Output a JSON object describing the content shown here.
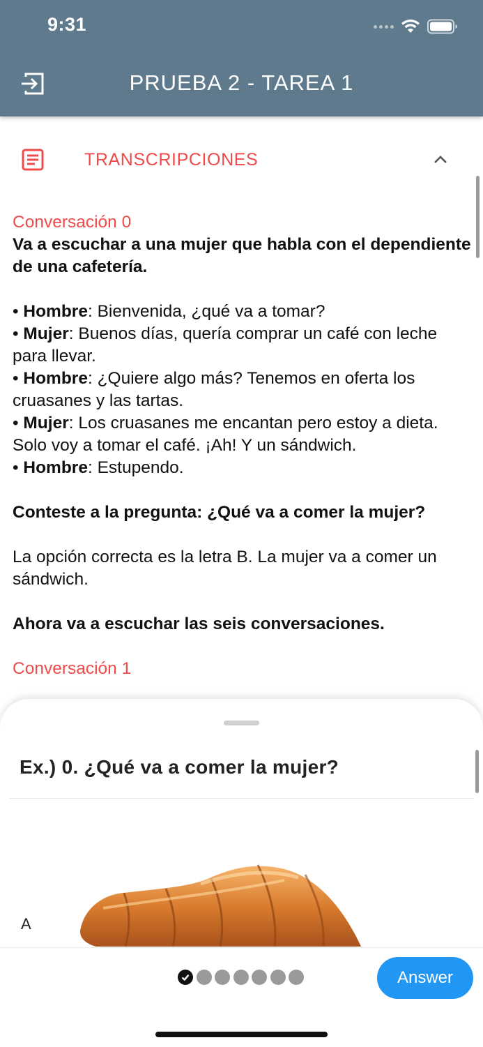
{
  "status": {
    "time": "9:31"
  },
  "header": {
    "title": "PRUEBA 2 - TAREA 1",
    "exit_icon": "exit-icon"
  },
  "accordion": {
    "title": "TRANSCRIPCIONES",
    "icon": "document-icon",
    "chevron": "chevron-up-icon"
  },
  "transcript": {
    "conv0_label": "Conversación 0",
    "intro": "Va a escuchar a una mujer que habla con el dependiente de una cafetería.",
    "lines": [
      {
        "speaker": "Hombre",
        "text": ": Bienvenida, ¿qué va a tomar?"
      },
      {
        "speaker": "Mujer",
        "text": ": Buenos días, quería comprar un café con leche para llevar."
      },
      {
        "speaker": "Hombre",
        "text": ": ¿Quiere algo más? Tenemos en oferta los cruasanes y las tartas."
      },
      {
        "speaker": "Mujer",
        "text": ": Los cruasanes me encantan pero estoy a dieta. Solo voy a tomar el café. ¡Ah! Y un sándwich."
      },
      {
        "speaker": "Hombre",
        "text": ": Estupendo."
      }
    ],
    "bullet": "•",
    "question": "Conteste a la pregunta: ¿Qué va a comer la mujer?",
    "answer": "La opción correcta es la letra B. La mujer va a comer un sándwich.",
    "outro": "Ahora va a escuchar las seis conversaciones.",
    "conv1_label": "Conversación 1"
  },
  "sheet": {
    "question": "Ex.) 0. ¿Qué va a comer la mujer?",
    "option_letter": "A",
    "option_image": "croissant-image"
  },
  "footer": {
    "progress": {
      "completed": 1,
      "total": 7
    },
    "answer_label": "Answer"
  }
}
